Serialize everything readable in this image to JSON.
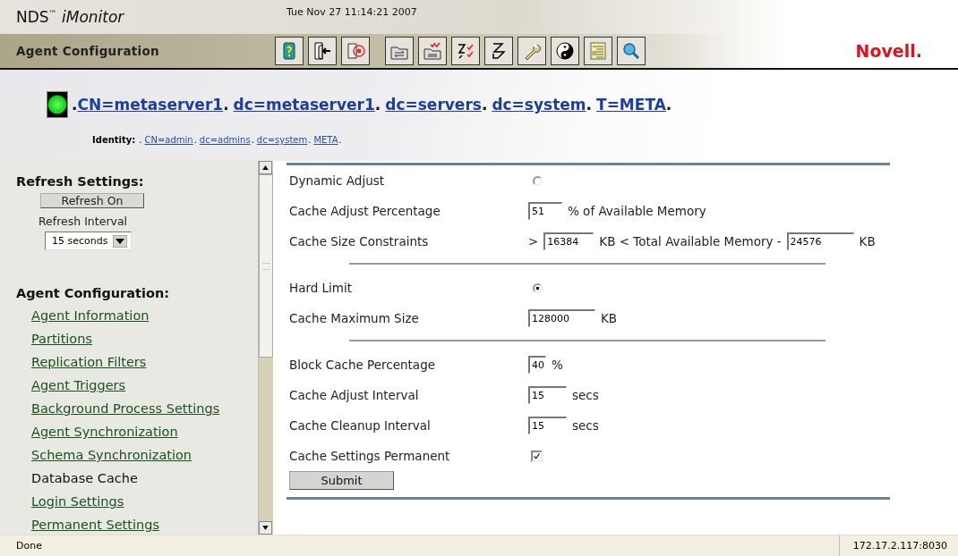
{
  "header": {
    "title": "NDS$^{™}$ *iMonitor*",
    "datetime": "Tue Nov 27 11:14:21 2007",
    "page_title": "Agent Configuration",
    "brand": "Novell."
  },
  "object": {
    "dn": [
      {
        "kind": "text",
        "text": "."
      },
      {
        "kind": "link",
        "text": "CN=metaserver1"
      },
      {
        "kind": "text",
        "text": "."
      },
      {
        "kind": "link",
        "text": "dc=metaserver1"
      },
      {
        "kind": "text",
        "text": "."
      },
      {
        "kind": "link",
        "text": "dc=servers"
      },
      {
        "kind": "text",
        "text": "."
      },
      {
        "kind": "link",
        "text": "dc=system"
      },
      {
        "kind": "text",
        "text": "."
      },
      {
        "kind": "link",
        "text": "T=META"
      },
      {
        "kind": "text",
        "text": "."
      }
    ],
    "identity_label": "Identity:",
    "identity": [
      {
        "kind": "text",
        "text": "."
      },
      {
        "kind": "link",
        "text": "CN=admin"
      },
      {
        "kind": "text",
        "text": "."
      },
      {
        "kind": "link",
        "text": "dc=admins"
      },
      {
        "kind": "text",
        "text": "."
      },
      {
        "kind": "link",
        "text": "dc=system"
      },
      {
        "kind": "text",
        "text": "."
      },
      {
        "kind": "link",
        "text": "META"
      },
      {
        "kind": "text",
        "text": "."
      }
    ]
  },
  "sidebar": {
    "refresh_heading": "Refresh Settings:",
    "refresh_button": "Refresh On",
    "interval_label": "Refresh Interval",
    "interval_value": "15 seconds",
    "section_heading": "Agent Configuration:",
    "items": [
      {
        "label": "Agent Information",
        "selected": false
      },
      {
        "label": "Partitions",
        "selected": false
      },
      {
        "label": "Replication Filters",
        "selected": false
      },
      {
        "label": "Agent Triggers",
        "selected": false
      },
      {
        "label": "Background Process Settings",
        "selected": false
      },
      {
        "label": "Agent Synchronization",
        "selected": false
      },
      {
        "label": "Schema Synchronization",
        "selected": false
      },
      {
        "label": "Database Cache",
        "selected": true
      },
      {
        "label": "Login Settings",
        "selected": false
      },
      {
        "label": "Permanent Settings",
        "selected": false
      }
    ]
  },
  "form": {
    "rows": [
      {
        "kind": "radio",
        "label": "Dynamic Adjust",
        "selected": false
      },
      {
        "kind": "fields",
        "label": "Cache Adjust Percentage",
        "parts": [
          {
            "kind": "input",
            "value": "51"
          },
          {
            "kind": "text",
            "text": "% of Available Memory"
          }
        ]
      },
      {
        "kind": "fields",
        "label": "Cache Size Constraints",
        "parts": [
          {
            "kind": "text",
            "text": ">"
          },
          {
            "kind": "input",
            "value": "16384"
          },
          {
            "kind": "text",
            "text": "KB < Total Available Memory -"
          },
          {
            "kind": "input",
            "value": "24576"
          },
          {
            "kind": "text",
            "text": "KB"
          }
        ]
      },
      {
        "kind": "divider"
      },
      {
        "kind": "radio",
        "label": "Hard Limit",
        "selected": true
      },
      {
        "kind": "fields",
        "label": "Cache Maximum Size",
        "parts": [
          {
            "kind": "input",
            "value": "128000"
          },
          {
            "kind": "text",
            "text": "KB"
          }
        ]
      },
      {
        "kind": "divider"
      },
      {
        "kind": "fields",
        "label": "Block Cache Percentage",
        "parts": [
          {
            "kind": "input",
            "value": "40"
          },
          {
            "kind": "text",
            "text": "%"
          }
        ]
      },
      {
        "kind": "fields",
        "label": "Cache Adjust Interval",
        "parts": [
          {
            "kind": "input",
            "value": "15"
          },
          {
            "kind": "text",
            "text": "secs"
          }
        ]
      },
      {
        "kind": "fields",
        "label": "Cache Cleanup Interval",
        "parts": [
          {
            "kind": "input",
            "value": "15"
          },
          {
            "kind": "text",
            "text": "secs"
          }
        ]
      },
      {
        "kind": "checkbox",
        "label": "Cache Settings Permanent",
        "checked": true
      }
    ],
    "submit": "Submit"
  },
  "status_bar": {
    "message": "Done",
    "address": "172.17.2.117:8030"
  }
}
